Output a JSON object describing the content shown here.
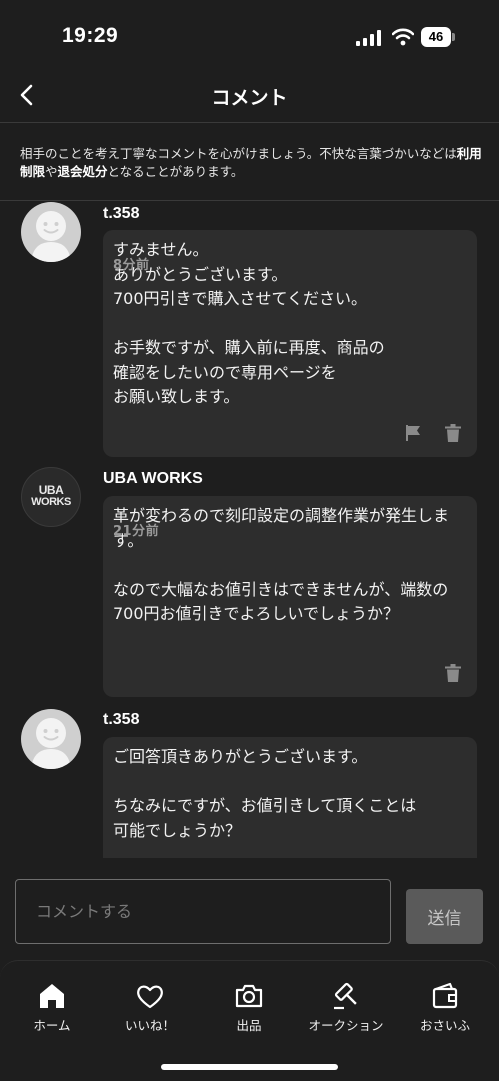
{
  "status_bar": {
    "time": "19:29",
    "battery": "46"
  },
  "header": {
    "title": "コメント"
  },
  "notice": {
    "part1": "相手のことを考え丁寧なコメントを心がけましょう。不快な言葉づかいなどは",
    "bold1": "利用制限",
    "part2": "や",
    "bold2": "退会処分",
    "part3": "となることがあります。"
  },
  "comments": [
    {
      "user": "t.358",
      "text": "すみません。\nありがとうございます。\n700円引きで購入させてください。\n\nお手数ですが、購入前に再度、商品の\n確認をしたいので専用ページを\nお願い致します。",
      "time": "8分前",
      "icons": [
        "flag-icon",
        "trash-icon"
      ]
    },
    {
      "user": "UBA WORKS",
      "avatar_text": [
        "UBA",
        "WORKS"
      ],
      "text": "革が変わるので刻印設定の調整作業が発生します。\n\nなので大幅なお値引きはできませんが、端数の700円お値引きでよろしいでしょうか？",
      "time": "21分前",
      "icons": [
        "trash-icon"
      ]
    },
    {
      "user": "t.358",
      "text": "ご回答頂きありがとうございます。\n\nちなみにですが、お値引きして頂くことは\n可能でしょうか？",
      "time": ""
    }
  ],
  "composer": {
    "placeholder": "コメントする",
    "send_label": "送信"
  },
  "tabs": [
    {
      "label": "ホーム",
      "icon": "home-icon"
    },
    {
      "label": "いいね！",
      "icon": "heart-icon"
    },
    {
      "label": "出品",
      "icon": "camera-icon"
    },
    {
      "label": "オークション",
      "icon": "gavel-icon"
    },
    {
      "label": "おさいふ",
      "icon": "wallet-icon"
    }
  ],
  "colors": {
    "background": "#1e1e1e",
    "bubble": "#2d2d2d",
    "send_button": "#5a5a5a"
  }
}
